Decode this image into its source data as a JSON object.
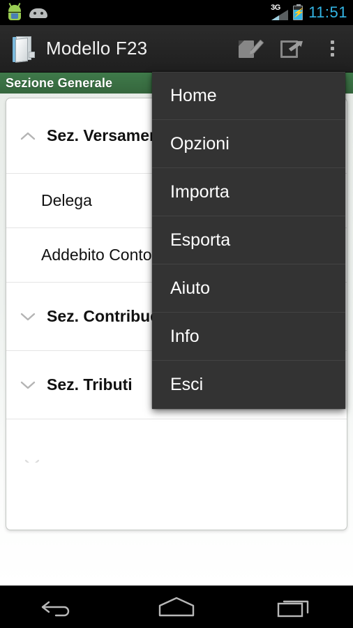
{
  "status_bar": {
    "icons": [
      "android-green-icon",
      "android-gray-icon",
      "signal-3g-icon",
      "battery-charging-icon"
    ],
    "network_label": "3G",
    "time": "11:51"
  },
  "action_bar": {
    "app_icon": "folder-icon",
    "title": "Modello F23",
    "actions": [
      {
        "name": "edit-icon",
        "label": "Modifica"
      },
      {
        "name": "export-icon",
        "label": "Esporta"
      },
      {
        "name": "overflow-icon",
        "label": "Altre opzioni"
      }
    ]
  },
  "section_header": {
    "title": "Sezione Generale",
    "color": "#35663d"
  },
  "list": {
    "rows": [
      {
        "label": "Sez. Versamento",
        "type": "group",
        "chevron": "chevron-up",
        "expanded": true
      },
      {
        "label": "Delega",
        "type": "item",
        "chevron": "none"
      },
      {
        "label": "Addebito Conto",
        "type": "item",
        "chevron": "none"
      },
      {
        "label": "Sez. Contribuente",
        "type": "group",
        "chevron": "chevron-down",
        "expanded": false
      },
      {
        "label": "Sez. Tributi",
        "type": "group",
        "chevron": "chevron-down",
        "expanded": false,
        "trailing_icon": "coins-icon"
      }
    ]
  },
  "overflow_menu": {
    "visible": true,
    "background": "#333333",
    "items": [
      {
        "label": "Home",
        "name": "menu-item-home"
      },
      {
        "label": "Opzioni",
        "name": "menu-item-opzioni"
      },
      {
        "label": "Importa",
        "name": "menu-item-importa"
      },
      {
        "label": "Esporta",
        "name": "menu-item-esporta"
      },
      {
        "label": "Aiuto",
        "name": "menu-item-aiuto"
      },
      {
        "label": "Info",
        "name": "menu-item-info"
      },
      {
        "label": "Esci",
        "name": "menu-item-esci"
      }
    ]
  },
  "nav_bar": {
    "buttons": [
      {
        "name": "back-icon",
        "label": "Indietro"
      },
      {
        "name": "home-icon",
        "label": "Home"
      },
      {
        "name": "recents-icon",
        "label": "App recenti"
      }
    ]
  }
}
